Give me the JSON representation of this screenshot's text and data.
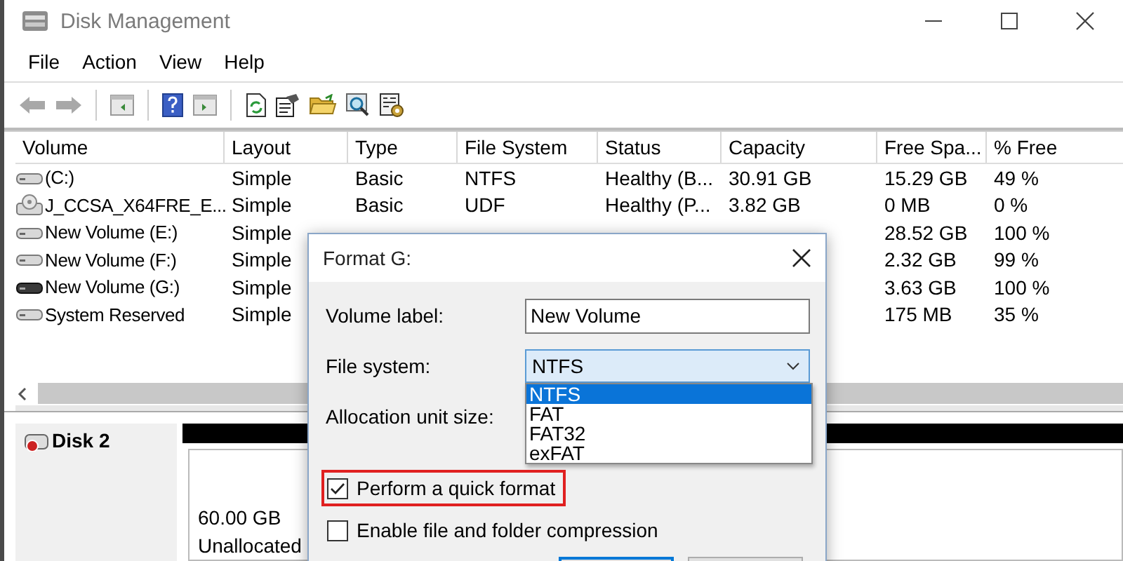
{
  "window": {
    "title": "Disk Management"
  },
  "menu": [
    "File",
    "Action",
    "View",
    "Help"
  ],
  "table": {
    "columns": [
      "Volume",
      "Layout",
      "Type",
      "File System",
      "Status",
      "Capacity",
      "Free Spa...",
      "% Free"
    ],
    "rows": [
      {
        "kind": "disk",
        "volume": "(C:)",
        "layout": "Simple",
        "type": "Basic",
        "file_system": "NTFS",
        "status": "Healthy (B...",
        "capacity": "30.91 GB",
        "free_space": "15.29 GB",
        "percent_free": "49 %"
      },
      {
        "kind": "optical",
        "volume": "J_CCSA_X64FRE_E...",
        "layout": "Simple",
        "type": "Basic",
        "file_system": "UDF",
        "status": "Healthy (P...",
        "capacity": "3.82 GB",
        "free_space": "0 MB",
        "percent_free": "0 %"
      },
      {
        "kind": "disk",
        "volume": "New Volume (E:)",
        "layout": "Simple",
        "free_space": "28.52 GB",
        "percent_free": "100 %"
      },
      {
        "kind": "disk",
        "volume": "New Volume (F:)",
        "layout": "Simple",
        "free_space": "2.32 GB",
        "percent_free": "99 %"
      },
      {
        "kind": "dark-disk",
        "volume": "New Volume (G:)",
        "layout": "Simple",
        "free_space": "3.63 GB",
        "percent_free": "100 %"
      },
      {
        "kind": "disk",
        "volume": "System Reserved",
        "layout": "Simple",
        "free_space": "175 MB",
        "percent_free": "35 %"
      }
    ]
  },
  "disk_pane": {
    "disk_name": "Disk 2",
    "partition": {
      "size": "60.00 GB",
      "status": "Unallocated"
    }
  },
  "dialog": {
    "title": "Format G:",
    "volume_label": {
      "label": "Volume label:",
      "value": "New Volume"
    },
    "file_system": {
      "label": "File system:",
      "value": "NTFS",
      "expanded": true,
      "options": [
        {
          "label": "NTFS",
          "selected": true
        },
        {
          "label": "FAT",
          "selected": false
        },
        {
          "label": "FAT32",
          "selected": false
        },
        {
          "label": "exFAT",
          "selected": false
        }
      ]
    },
    "allocation": {
      "label": "Allocation unit size:"
    },
    "checkboxes": [
      {
        "label": "Perform a quick format",
        "checked": true,
        "highlighted": true
      },
      {
        "label": "Enable file and folder compression",
        "checked": false,
        "highlighted": false
      }
    ]
  }
}
